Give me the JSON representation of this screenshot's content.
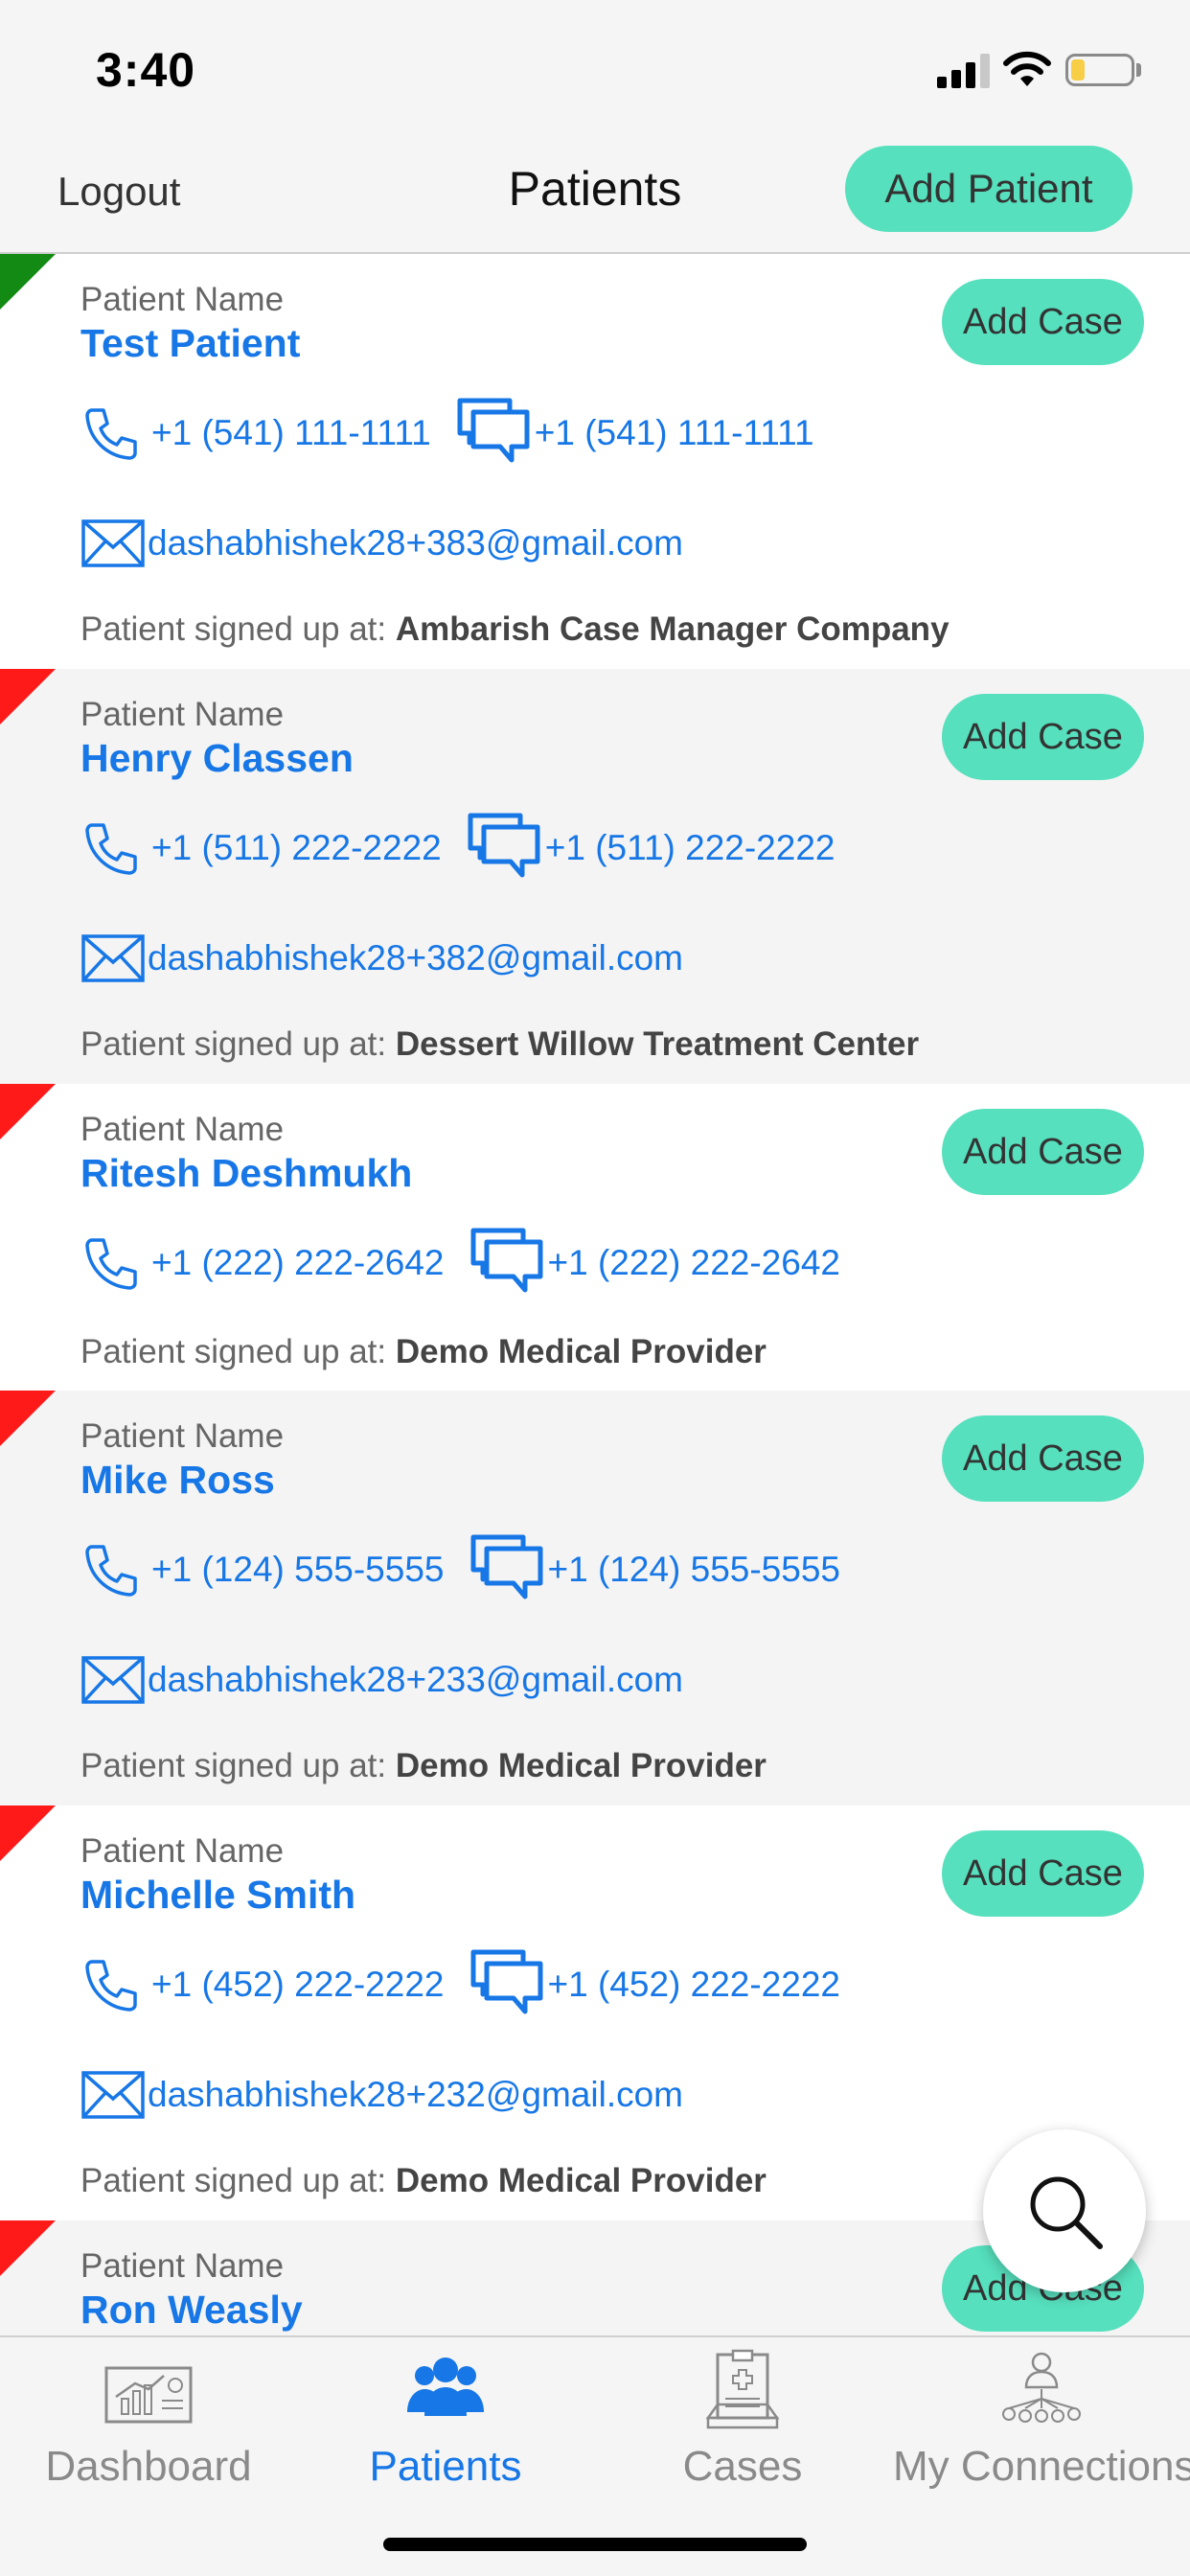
{
  "status_bar": {
    "time": "3:40"
  },
  "header": {
    "logout_label": "Logout",
    "title": "Patients",
    "add_patient_label": "Add Patient"
  },
  "patients": [
    {
      "label": "Patient Name",
      "name": "Test Patient",
      "add_case_label": "Add Case",
      "phone": "+1 (541) 111-1111",
      "sms": "+1 (541) 111-1111",
      "email": "dashabhishek28+383@gmail.com",
      "signup_label": "Patient signed up at:",
      "signup_org": "Ambarish Case Manager Company",
      "status_color": "#138a13",
      "bg": "white"
    },
    {
      "label": "Patient Name",
      "name": "Henry Classen",
      "add_case_label": "Add Case",
      "phone": "+1 (511) 222-2222",
      "sms": "+1 (511) 222-2222",
      "email": "dashabhishek28+382@gmail.com",
      "signup_label": "Patient signed up at:",
      "signup_org": "Dessert Willow Treatment Center",
      "status_color": "#ff1a1a",
      "bg": "grey"
    },
    {
      "label": "Patient Name",
      "name": "Ritesh Deshmukh",
      "add_case_label": "Add Case",
      "phone": "+1 (222) 222-2642",
      "sms": "+1 (222) 222-2642",
      "email": "",
      "signup_label": "Patient signed up at:",
      "signup_org": "Demo Medical Provider",
      "status_color": "#ff1a1a",
      "bg": "white"
    },
    {
      "label": "Patient Name",
      "name": "Mike Ross",
      "add_case_label": "Add Case",
      "phone": "+1 (124) 555-5555",
      "sms": "+1 (124) 555-5555",
      "email": "dashabhishek28+233@gmail.com",
      "signup_label": "Patient signed up at:",
      "signup_org": "Demo Medical Provider",
      "status_color": "#ff1a1a",
      "bg": "grey"
    },
    {
      "label": "Patient Name",
      "name": "Michelle Smith",
      "add_case_label": "Add Case",
      "phone": "+1 (452) 222-2222",
      "sms": "+1 (452) 222-2222",
      "email": "dashabhishek28+232@gmail.com",
      "signup_label": "Patient signed up at:",
      "signup_org": "Demo Medical Provider",
      "status_color": "#ff1a1a",
      "bg": "white"
    },
    {
      "label": "Patient Name",
      "name": "Ron Weasly",
      "add_case_label": "Add Case",
      "status_color": "#ff1a1a",
      "bg": "grey"
    }
  ],
  "tabs": [
    {
      "label": "Dashboard",
      "icon": "dashboard-icon",
      "active": false
    },
    {
      "label": "Patients",
      "icon": "patients-icon",
      "active": true
    },
    {
      "label": "Cases",
      "icon": "cases-icon",
      "active": false
    },
    {
      "label": "My Connections",
      "icon": "connections-icon",
      "active": false
    }
  ],
  "colors": {
    "accent": "#56e0bd",
    "link": "#1777e6",
    "active_tab": "#1777e6",
    "inactive_tab": "#8a8a8a"
  }
}
